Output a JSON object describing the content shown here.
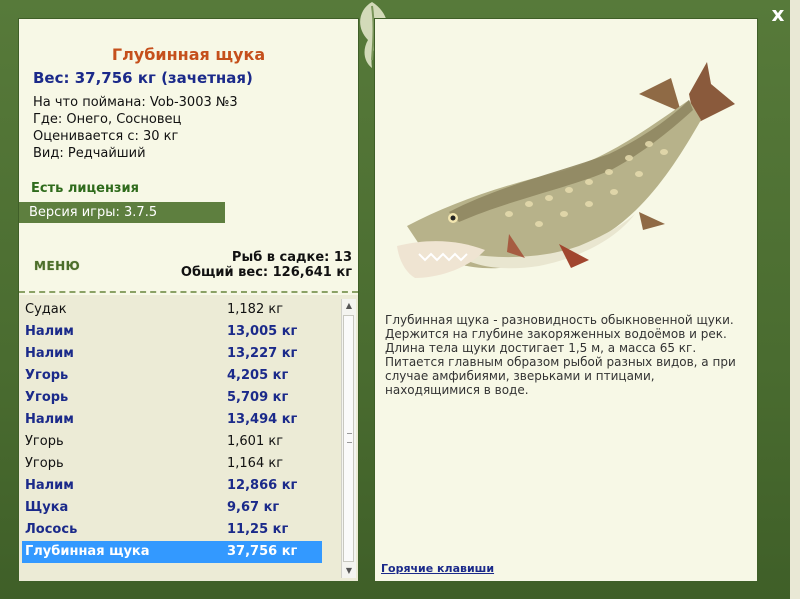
{
  "close_label": "x",
  "fish": {
    "title": "Глубинная щука",
    "weight": "Вес: 37,756 кг (зачетная)",
    "bait": "На что поймана: Vob-3003 №3",
    "place": "Где: Онего, Сосновец",
    "value": "Оценивается с: 30 кг",
    "kind": "Вид: Редчайший"
  },
  "license": "Есть лицензия",
  "version": "Версия игры: 3.7.5",
  "menu_label": "МЕНЮ",
  "cage": {
    "count": "Рыб в садке: 13",
    "total": "Общий вес: 126,641 кг"
  },
  "catch_list": [
    {
      "name": "Судак",
      "weight": "1,182 кг",
      "style": "plain"
    },
    {
      "name": "Налим",
      "weight": "13,005 кг",
      "style": "bold"
    },
    {
      "name": "Налим",
      "weight": "13,227 кг",
      "style": "bold"
    },
    {
      "name": "Угорь",
      "weight": "4,205 кг",
      "style": "bold"
    },
    {
      "name": "Угорь",
      "weight": "5,709 кг",
      "style": "bold"
    },
    {
      "name": "Налим",
      "weight": "13,494 кг",
      "style": "bold"
    },
    {
      "name": "Угорь",
      "weight": "1,601 кг",
      "style": "plain"
    },
    {
      "name": "Угорь",
      "weight": "1,164 кг",
      "style": "plain"
    },
    {
      "name": "Налим",
      "weight": "12,866 кг",
      "style": "bold"
    },
    {
      "name": "Щука",
      "weight": "9,67 кг",
      "style": "bold"
    },
    {
      "name": "Лосось",
      "weight": "11,25 кг",
      "style": "bold"
    },
    {
      "name": "Глубинная щука",
      "weight": "37,756 кг",
      "style": "sel"
    }
  ],
  "description": "Глубинная щука - разновидность обыкновенной щуки. Держится на глубине закоряженных водоёмов и рек. Длина тела щуки достигает 1,5 м, а масса 65 кг. Питается главным образом рыбой разных видов, а при случае амфибиями, зверьками и птицами, находящимися в воде.",
  "hotkeys_label": "Горячие клавиши",
  "colors": {
    "frame": "#5e7f3f",
    "title": "#c5501c",
    "accent": "#1b2a8a",
    "selection": "#3399ff"
  }
}
